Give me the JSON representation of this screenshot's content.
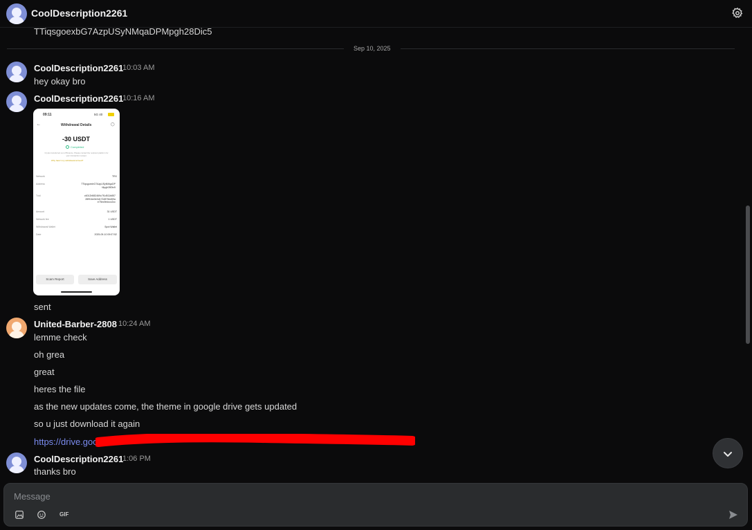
{
  "header": {
    "title": "CoolDescription2261"
  },
  "prev_message_tail": "TTiqsgoexbG7AzpUSyNMqaDPMpgh28Dic5",
  "date_separator": "Sep 10, 2025",
  "messages": [
    {
      "username": "CoolDescription2261",
      "time": "10:03 AM",
      "lines": [
        "hey okay bro"
      ]
    },
    {
      "username": "CoolDescription2261",
      "time": "10:16 AM",
      "lines": [
        "sent"
      ]
    },
    {
      "username": "United-Barber-2808",
      "time": "10:24 AM",
      "lines": [
        "lemme check",
        "oh grea",
        "great",
        "heres the file",
        "as the new updates come, the theme in google drive gets updated",
        "so u just download it again",
        "https://drive.goo"
      ]
    },
    {
      "username": "CoolDescription2261",
      "time": "1:06 PM",
      "lines": [
        "thanks bro"
      ]
    }
  ],
  "attachment": {
    "status_time": "09:11",
    "status_right": "5G 40",
    "title": "Withdrawal Details",
    "amount": "-30 USDT",
    "status": "Completed",
    "note": "Crypto transferred out of Binance. Please contact the recipient platform for your transaction receipt.",
    "link": "Why hasn't my withdrawal arrived?",
    "rows": [
      {
        "label": "Network",
        "value": "TRX"
      },
      {
        "label": "Address",
        "value": "TTiqsgoexbG7AzpUSyNMqaDP Mpgh28Dic5"
      },
      {
        "label": "Txid",
        "value": "c6012b582469c7f1d511b857 28f91be0e0d172d575ed59a e75ec9edccc2cc"
      },
      {
        "label": "Amount",
        "value": "31 USDT"
      },
      {
        "label": "Network fee",
        "value": "1 USDT"
      },
      {
        "label": "Withdrawal Wallet",
        "value": "Spot Wallet"
      },
      {
        "label": "Date",
        "value": "2025-09-10 09:07:52"
      }
    ],
    "buttons": [
      "Scam Report",
      "Save Address"
    ]
  },
  "composer": {
    "placeholder": "Message",
    "gif_label": "GIF"
  },
  "colors": {
    "background": "#0b0b0c",
    "link": "#7b8cf0",
    "avatar_blue": "#7f8fd6",
    "avatar_orange": "#f0a86f",
    "composer": "#2a2c2e"
  },
  "icons": [
    "settings-gear-icon",
    "image-icon",
    "emoji-icon",
    "gif-icon",
    "send-icon",
    "chevron-down-icon"
  ]
}
